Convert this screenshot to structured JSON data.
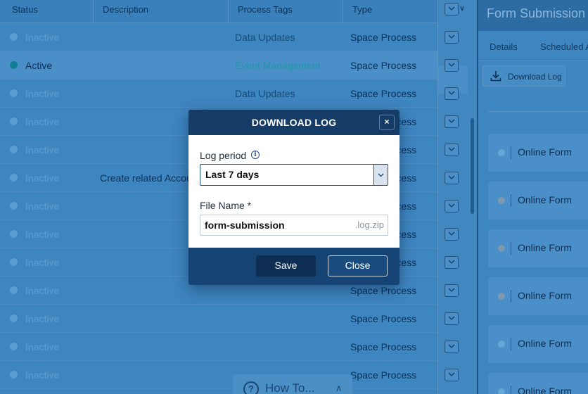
{
  "table": {
    "headers": [
      "Status",
      "Description",
      "Process Tags",
      "Type"
    ],
    "rows": [
      {
        "status": "Inactive",
        "description": "",
        "tag": "",
        "type": "Space Process"
      },
      {
        "status": "Inactive",
        "description": "",
        "tag": "Data Updates",
        "type": "Space Process"
      },
      {
        "status": "Active",
        "description": "",
        "tag": "Event Management",
        "type": "Space Process"
      },
      {
        "status": "Inactive",
        "description": "",
        "tag": "Data Updates",
        "type": "Space Process"
      },
      {
        "status": "Inactive",
        "description": "",
        "tag": "",
        "type": "Space Process"
      },
      {
        "status": "Inactive",
        "description": "",
        "tag": "",
        "type": "Space Process"
      },
      {
        "status": "Inactive",
        "description": "Create related Accou",
        "tag": "",
        "type": "Space Process"
      },
      {
        "status": "Inactive",
        "description": "",
        "tag": "",
        "type": "Space Process"
      },
      {
        "status": "Inactive",
        "description": "",
        "tag": "",
        "type": "Space Process"
      },
      {
        "status": "Inactive",
        "description": "",
        "tag": "",
        "type": "Space Process"
      },
      {
        "status": "Inactive",
        "description": "",
        "tag": "",
        "type": "Space Process"
      },
      {
        "status": "Inactive",
        "description": "",
        "tag": "",
        "type": "Space Process"
      },
      {
        "status": "Inactive",
        "description": "",
        "tag": "",
        "type": "Space Process"
      },
      {
        "status": "Inactive",
        "description": "",
        "tag": "",
        "type": "Space Process"
      }
    ]
  },
  "right_panel": {
    "title": "Form Submission",
    "tabs": [
      "Details",
      "Scheduled A"
    ],
    "download_log_label": "Download Log",
    "items": [
      {
        "label": "Online Form"
      },
      {
        "label": "Online Form"
      },
      {
        "label": "Online Form"
      },
      {
        "label": "Online Form"
      },
      {
        "label": "Online Form"
      },
      {
        "label": "Online Form"
      }
    ]
  },
  "howto": {
    "label": "How To..."
  },
  "modal": {
    "title": "DOWNLOAD LOG",
    "close_glyph": "×",
    "log_period_label": "Log period",
    "log_period_value": "Last 7 days",
    "file_name_label": "File Name *",
    "file_name_value": "form-submission",
    "file_suffix": ".log.zip",
    "save_label": "Save",
    "close_label": "Close"
  },
  "colors": {
    "modal_header": "#143c66",
    "modal_footer": "#154474",
    "active_dot": "#0f7e94",
    "active_tag": "#1a9aa6"
  },
  "icons": [
    "columns-icon",
    "chevron-down-icon",
    "download-icon",
    "info-icon",
    "help-icon",
    "chevron-up-icon",
    "close-icon"
  ]
}
